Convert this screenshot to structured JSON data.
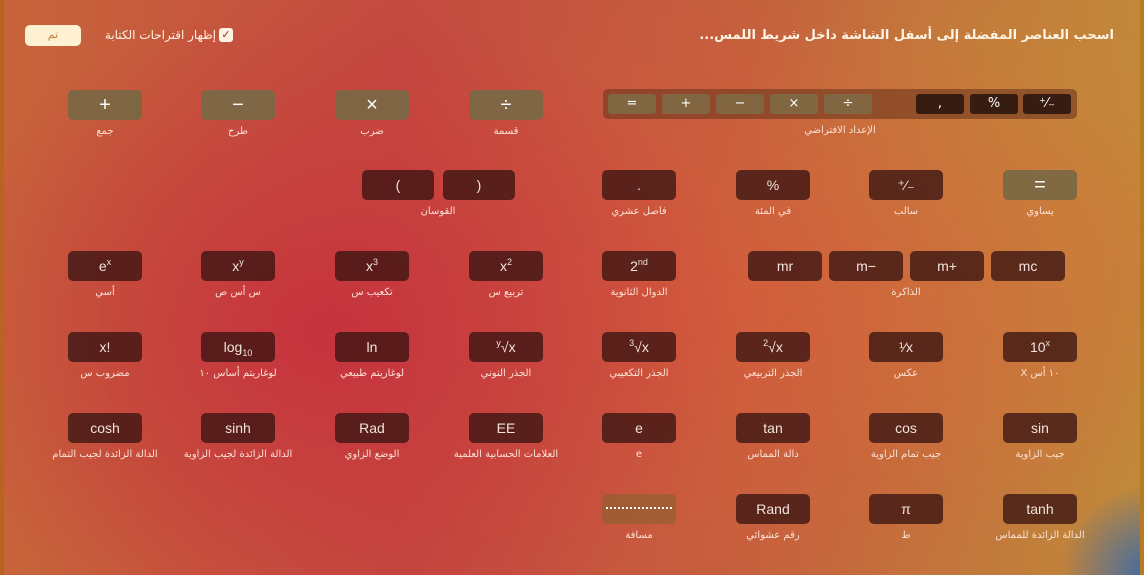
{
  "header": {
    "instruction": "اسحب العناصر المفضلة إلى أسفل الشاشة داخل شريط اللمس...",
    "show_typing_suggestions_label": "إظهار اقتراحات الكتابة",
    "show_typing_suggestions_checked": true,
    "done_label": "تم"
  },
  "default_set": {
    "label": "الإعداد الافتراضي",
    "items": [
      "=",
      "+",
      "−",
      "×",
      "÷",
      ",",
      "%",
      "⁺⁄₋"
    ]
  },
  "groups": {
    "parentheses": {
      "label": "القوسان",
      "items": [
        "(",
        ")"
      ]
    },
    "memory": {
      "label": "الذاكرة",
      "items": [
        "mr",
        "m−",
        "m+",
        "mc"
      ]
    }
  },
  "items": [
    {
      "id": "add",
      "text": "+",
      "label": "جمع"
    },
    {
      "id": "subtract",
      "text": "−",
      "label": "طرح"
    },
    {
      "id": "multiply",
      "text": "×",
      "label": "ضرب"
    },
    {
      "id": "divide",
      "text": "÷",
      "label": "قسمة"
    },
    {
      "id": "decimal",
      "text": ".",
      "label": "فاصل عشري"
    },
    {
      "id": "percent",
      "text": "%",
      "label": "في المئة"
    },
    {
      "id": "sign",
      "text": "⁺⁄₋",
      "label": "سالب"
    },
    {
      "id": "equals",
      "text": "=",
      "label": "يساوي"
    },
    {
      "id": "exp",
      "text": "e",
      "sup": "x",
      "label": "أسي"
    },
    {
      "id": "x-pow-y",
      "text": "x",
      "sup": "y",
      "label": "س أس ص"
    },
    {
      "id": "cube",
      "text": "x",
      "sup": "3",
      "label": "تكعيب س"
    },
    {
      "id": "square",
      "text": "x",
      "sup": "2",
      "label": "تربيع س"
    },
    {
      "id": "second",
      "text": "2",
      "sup": "nd",
      "label": "الدوال الثانوية"
    },
    {
      "id": "factorial",
      "text": "x!",
      "label": "مضروب س"
    },
    {
      "id": "log10",
      "text": "log",
      "sub": "10",
      "label": "لوغاريتم أساس ١٠"
    },
    {
      "id": "ln",
      "text": "ln",
      "label": "لوغاريتم طبيعي"
    },
    {
      "id": "nth-root",
      "pre": "y",
      "text": "√x",
      "label": "الجذر النوني"
    },
    {
      "id": "cube-root",
      "pre": "3",
      "text": "√x",
      "label": "الجذر التكعيبي"
    },
    {
      "id": "square-root",
      "pre": "2",
      "text": "√x",
      "label": "الجذر التربيعي"
    },
    {
      "id": "reciprocal",
      "text": "¹⁄x",
      "label": "عكس"
    },
    {
      "id": "ten-pow-x",
      "text": "10",
      "sup": "x",
      "label": "١٠ أس X"
    },
    {
      "id": "cosh",
      "text": "cosh",
      "label": "الدالة الزائدة لجيب التمام"
    },
    {
      "id": "sinh",
      "text": "sinh",
      "label": "الدالة الزائدة لجيب الزاوية"
    },
    {
      "id": "rad",
      "text": "Rad",
      "label": "الوضع الزاوي"
    },
    {
      "id": "ee",
      "text": "EE",
      "label": "العلامات الحسابية العلمية"
    },
    {
      "id": "e",
      "text": "e",
      "label": "e"
    },
    {
      "id": "tan",
      "text": "tan",
      "label": "دالة المماس"
    },
    {
      "id": "cos",
      "text": "cos",
      "label": "جيب تمام الزاوية"
    },
    {
      "id": "sin",
      "text": "sin",
      "label": "جيب الزاوية"
    },
    {
      "id": "space",
      "text": "",
      "spacer": true,
      "label": "مسافة"
    },
    {
      "id": "rand",
      "text": "Rand",
      "label": "رقم عشوائي"
    },
    {
      "id": "pi",
      "text": "π",
      "label": "ط"
    },
    {
      "id": "tanh",
      "text": "tanh",
      "label": "الدالة الزائدة للمماس"
    }
  ]
}
